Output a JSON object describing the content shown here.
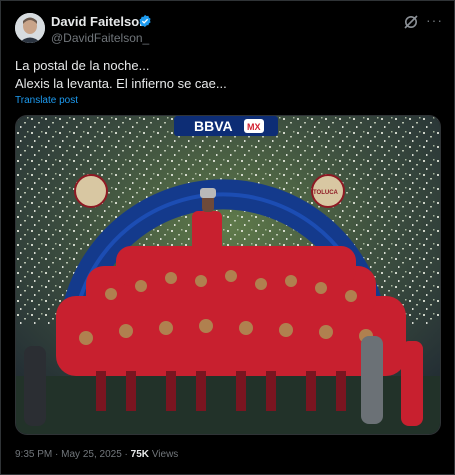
{
  "author": {
    "display_name": "David Faitelson",
    "handle": "@DavidFaitelson_",
    "verified": true
  },
  "actions": {
    "grok_icon": "grok-icon",
    "more_icon": "more-dots-icon",
    "more_label": "···"
  },
  "post": {
    "line1": "La postal de la noche...",
    "line2": "Alexis la levanta. El infierno se cae...",
    "translate_label": "Translate post"
  },
  "media": {
    "banner_text": "BBVA",
    "banner_badge": "MX",
    "team_badge_text": "TOLUCA"
  },
  "meta": {
    "time": "9:35 PM",
    "separator": "·",
    "date": "May 25, 2025",
    "views_count": "75K",
    "views_label": "Views"
  },
  "colors": {
    "background": "#000000",
    "link": "#1d9bf0",
    "muted": "#71767b",
    "verified": "#1d9bf0",
    "team_red": "#c8202f"
  }
}
